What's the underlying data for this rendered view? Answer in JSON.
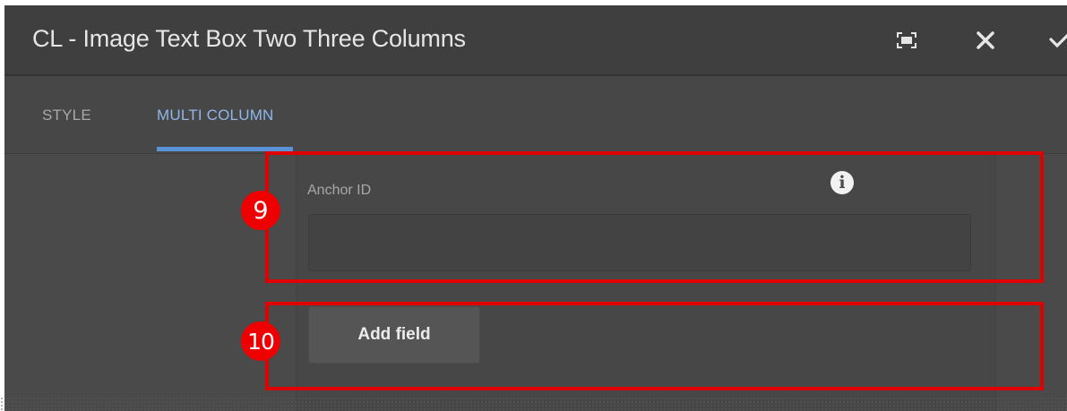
{
  "dialog": {
    "title": "CL - Image Text Box Two Three Columns",
    "actions": [
      {
        "name": "fullscreen-icon",
        "glyph": "fullscreen"
      },
      {
        "name": "close-icon",
        "glyph": "×"
      },
      {
        "name": "checkmark-icon",
        "glyph": "✓"
      }
    ]
  },
  "tabs": [
    {
      "label": "STYLE",
      "active": false
    },
    {
      "label": "MULTI COLUMN",
      "active": true
    }
  ],
  "form": {
    "anchor_label": "Anchor ID",
    "anchor_value": "",
    "add_field_label": "Add field"
  },
  "annotations": {
    "badge_9": "9",
    "badge_10": "10",
    "color": "#e00000"
  },
  "colors": {
    "accent": "#5b93d8",
    "active_tab_text": "#8fb7ea",
    "dialog_bg": "#4a4a4a",
    "titlebar_bg": "#3f3f3f"
  }
}
